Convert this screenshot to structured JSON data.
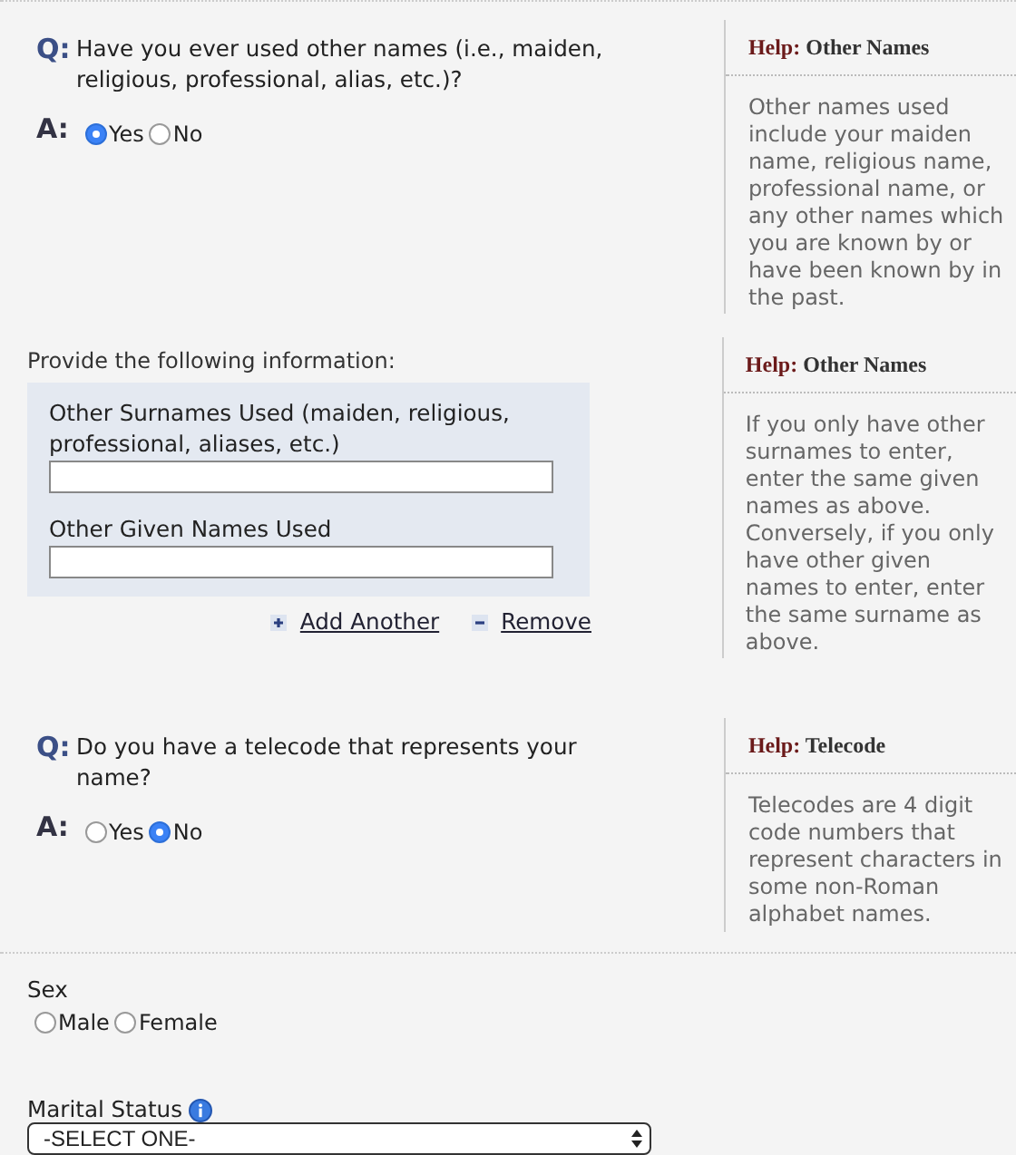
{
  "sections": [
    {
      "kind": "question",
      "question": {
        "marker": "Q:",
        "text": "Have you ever used other names (i.e., maiden, religious, professional, alias, etc.)?"
      },
      "answer": {
        "marker": "A:",
        "options": [
          {
            "label": "Yes",
            "selected": true
          },
          {
            "label": "No",
            "selected": false
          }
        ]
      },
      "help": {
        "prefix": "Help:",
        "title": "Other Names",
        "text": "Other names used include your maiden name, religious name, professional name, or any other names which you are known by or have been known by in the past."
      }
    },
    {
      "kind": "fields",
      "intro": "Provide the following information:",
      "fields": [
        {
          "label": "Other Surnames Used (maiden, religious, professional, aliases, etc.)"
        },
        {
          "label": "Other Given Names Used"
        }
      ],
      "actions": [
        {
          "kind": "add",
          "label": "Add Another"
        },
        {
          "kind": "remove",
          "label": "Remove"
        }
      ],
      "help": {
        "prefix": "Help:",
        "title": "Other Names",
        "text": "If you only have other surnames to enter, enter the same given names as above. Conversely, if you only have other given names to enter, enter the same surname as above."
      }
    },
    {
      "kind": "question",
      "question": {
        "marker": "Q:",
        "text": "Do you have a telecode that represents your name?"
      },
      "answer": {
        "marker": "A:",
        "options": [
          {
            "label": "Yes",
            "selected": false
          },
          {
            "label": "No",
            "selected": true
          }
        ]
      },
      "help": {
        "prefix": "Help:",
        "title": "Telecode",
        "text": "Telecodes are 4 digit code numbers that represent characters in some non-Roman alphabet names."
      }
    }
  ],
  "sex": {
    "label": "Sex",
    "options": [
      {
        "label": "Male",
        "selected": false
      },
      {
        "label": "Female",
        "selected": false
      }
    ]
  },
  "marital_status": {
    "label": "Marital Status",
    "value": "-SELECT ONE-"
  }
}
